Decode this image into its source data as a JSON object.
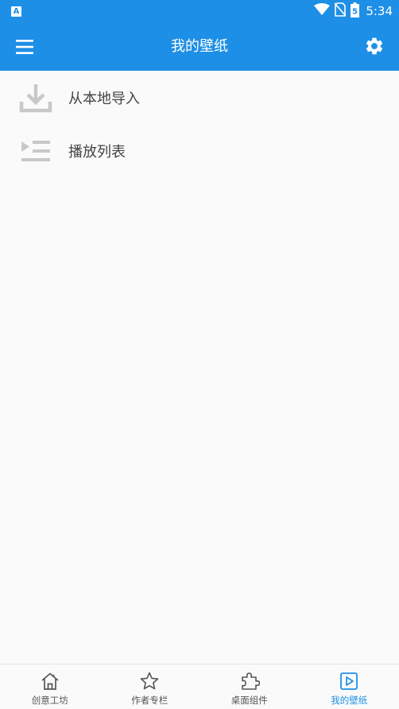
{
  "status_bar": {
    "left_badge": "A",
    "time": "5:34",
    "battery_level": "5"
  },
  "app_bar": {
    "title": "我的壁纸",
    "menu_icon": "menu-icon",
    "settings_icon": "gear-icon"
  },
  "list": {
    "items": [
      {
        "label": "从本地导入",
        "icon": "download-icon"
      },
      {
        "label": "播放列表",
        "icon": "playlist-icon"
      }
    ]
  },
  "bottom_nav": {
    "items": [
      {
        "label": "创意工坊",
        "icon": "home-icon",
        "active": false
      },
      {
        "label": "作者专栏",
        "icon": "star-icon",
        "active": false
      },
      {
        "label": "桌面组件",
        "icon": "puzzle-icon",
        "active": false
      },
      {
        "label": "我的壁纸",
        "icon": "play-box-icon",
        "active": true
      }
    ]
  },
  "colors": {
    "primary": "#1e8fe6",
    "background": "#fafafa",
    "icon_gray": "#c8c8c8",
    "nav_icon": "#555555"
  }
}
